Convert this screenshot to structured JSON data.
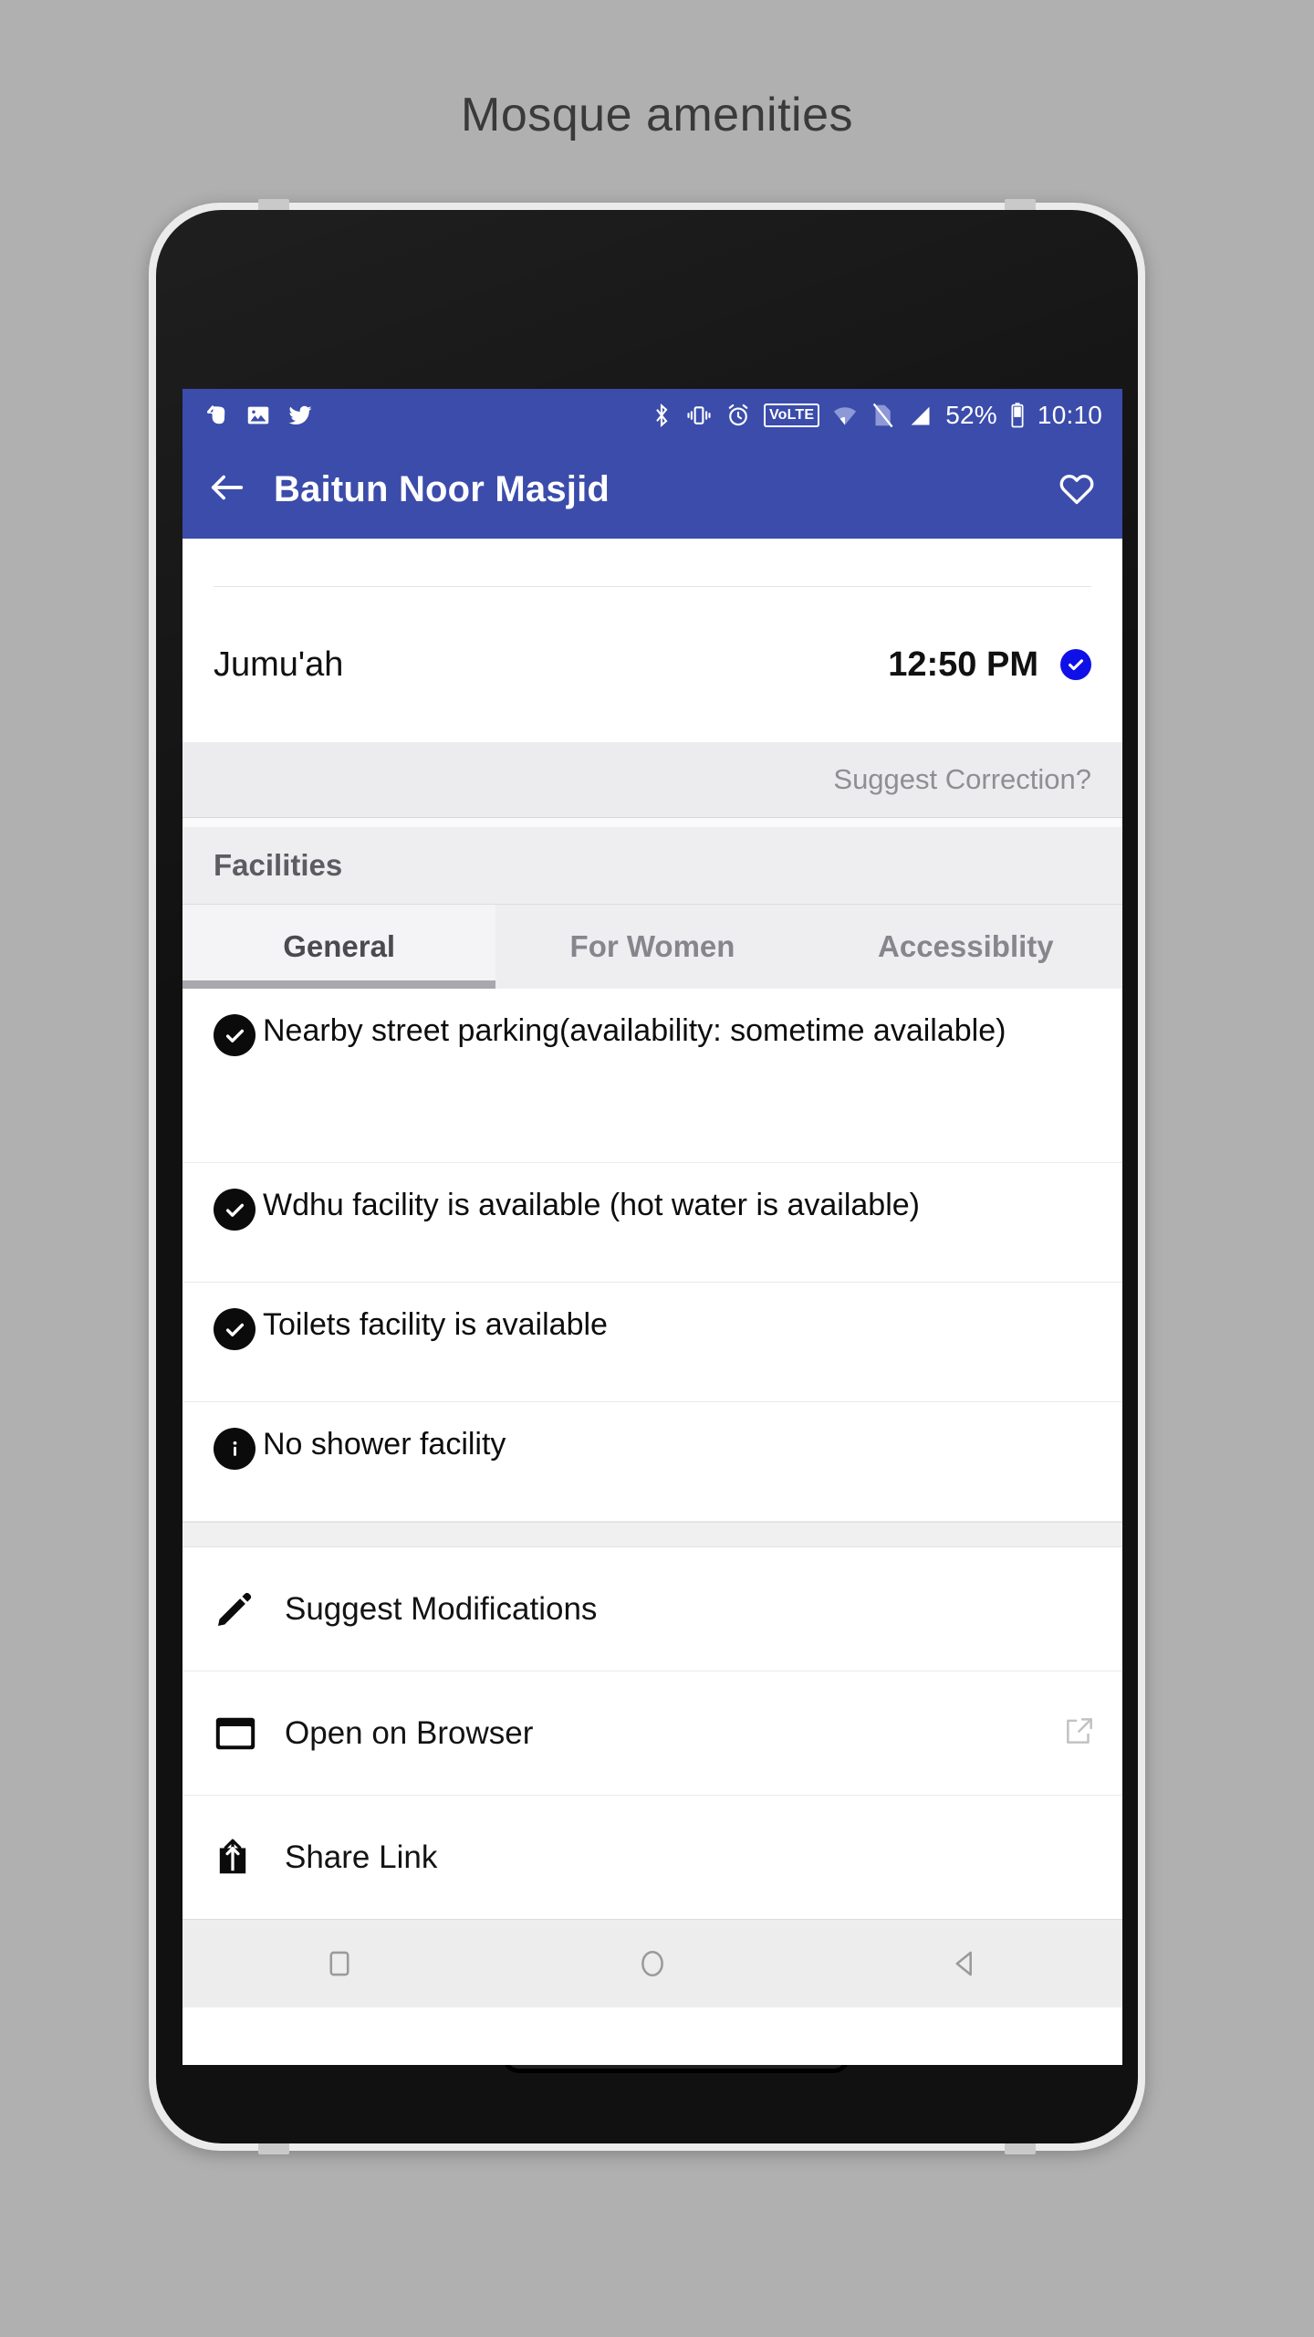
{
  "caption": "Mosque amenities",
  "status_bar": {
    "left_icons": [
      "evernote-icon",
      "gallery-icon",
      "twitter-icon"
    ],
    "right_icons": [
      "bluetooth-icon",
      "vibrate-icon",
      "alarm-icon",
      "volte-icon",
      "wifi-icon",
      "no-sim-icon",
      "signal-icon"
    ],
    "volte_label": "VoLTE",
    "battery_percent": "52%",
    "time": "10:10"
  },
  "app_bar": {
    "back_icon": "arrow-left-icon",
    "title": "Baitun Noor Masjid",
    "favorite_icon": "heart-outline-icon"
  },
  "prayer": {
    "name": "Jumu'ah",
    "time": "12:50 PM",
    "verified_icon": "verified-check-icon"
  },
  "suggest_correction": "Suggest Correction?",
  "facilities": {
    "header": "Facilities",
    "tabs": [
      {
        "label": "General",
        "active": true
      },
      {
        "label": "For Women",
        "active": false
      },
      {
        "label": "Accessiblity",
        "active": false
      }
    ],
    "items": [
      {
        "icon": "check-badge-icon",
        "text": "Nearby street parking(availability: sometime available)"
      },
      {
        "icon": "check-badge-icon",
        "text": "Wdhu facility is available (hot water is available)"
      },
      {
        "icon": "check-badge-icon",
        "text": "Toilets facility is available"
      },
      {
        "icon": "info-badge-icon",
        "text": "No shower facility"
      }
    ]
  },
  "actions": [
    {
      "icon": "pencil-icon",
      "label": "Suggest Modifications",
      "trailing": ""
    },
    {
      "icon": "browser-window-icon",
      "label": "Open on Browser",
      "trailing": "external-link-icon"
    },
    {
      "icon": "share-upload-icon",
      "label": "Share Link",
      "trailing": ""
    }
  ],
  "nav_bar": {
    "recents_icon": "square-icon",
    "home_icon": "circle-icon",
    "back_icon": "triangle-back-icon"
  },
  "colors": {
    "appbar_blue": "#3b4cab",
    "verified_blue": "#0f10e8",
    "page_bg": "#b0b0b0",
    "tab_indicator": "#a8a8ae"
  }
}
